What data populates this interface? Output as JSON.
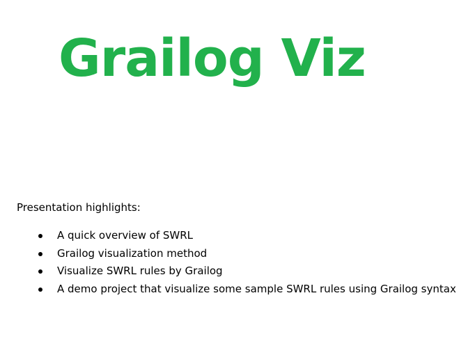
{
  "title": "Grailog Viz",
  "colors": {
    "title": "#22b14c",
    "text": "#000000",
    "background": "#ffffff"
  },
  "subtitle": "Presentation highlights:",
  "bullets": [
    "A quick overview of SWRL",
    "Grailog visualization method",
    "Visualize SWRL rules by Grailog",
    "A demo project that visualize some sample SWRL rules using Grailog syntax"
  ]
}
